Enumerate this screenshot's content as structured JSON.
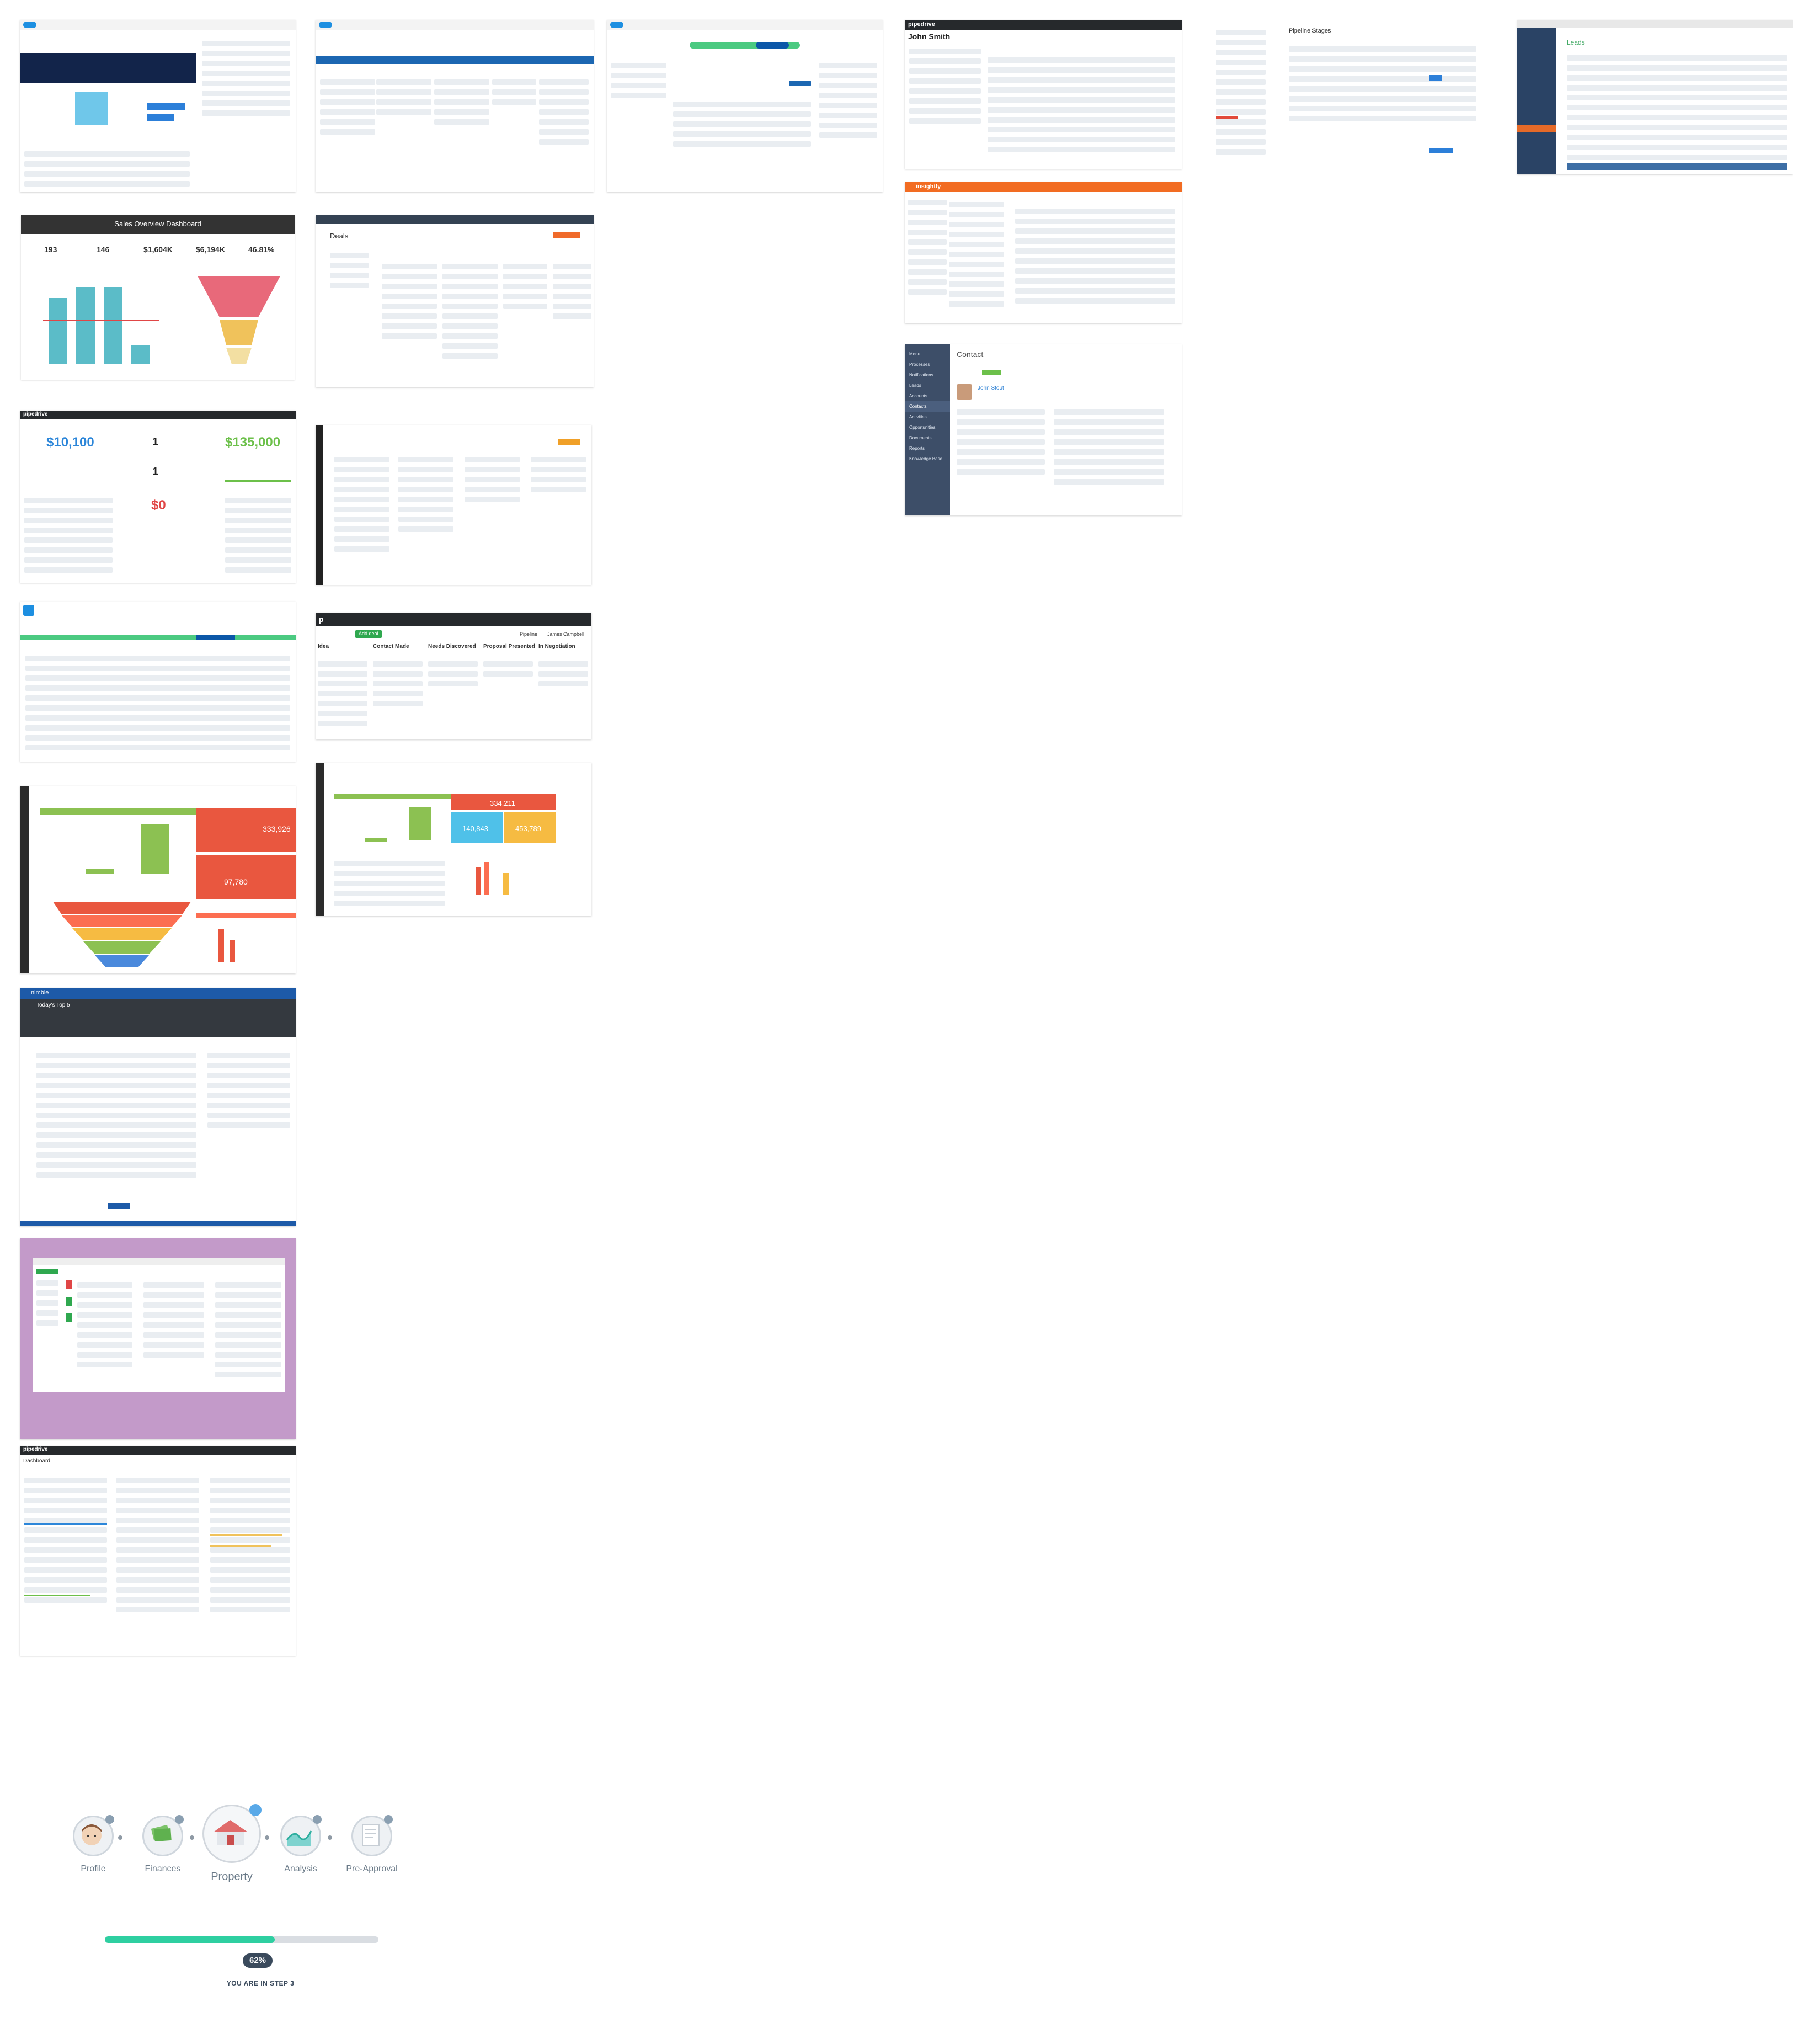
{
  "thumbnails": {
    "sales_dashboard": {
      "title": "Sales Overview Dashboard",
      "kpis": [
        "193",
        "146",
        "$1,604K",
        "$6,194K",
        "46.81%"
      ]
    },
    "deals_board": {
      "title": "Deals"
    },
    "pipedrive_dashboard": {
      "brand": "pipedrive",
      "won_value": "$10,100",
      "won_big": "$135,000",
      "lost_value": "$0",
      "counts": [
        "1",
        "1",
        "1"
      ]
    },
    "pipedrive_pipeline": {
      "brand": "p",
      "add_deal": "Add deal",
      "stages": [
        "Idea",
        "Contact Made",
        "Needs Discovered",
        "Proposal Presented",
        "In Negotiation"
      ],
      "pipeline_label": "Pipeline",
      "owner": "James Campbell"
    },
    "contact": {
      "title": "Contact",
      "name": "John Stout",
      "menu": [
        "Menu",
        "Processes",
        "Notifications",
        "Leads",
        "Accounts",
        "Contacts",
        "Activities",
        "Opportunities",
        "Documents",
        "Reports",
        "Knowledge Base"
      ]
    },
    "john_smith": {
      "brand": "pipedrive",
      "name": "John Smith"
    },
    "leads": {
      "title": "Leads"
    },
    "pipeline_stages": {
      "title": "Pipeline Stages"
    },
    "insightly": {
      "brand": "insightly"
    },
    "dash_a": {
      "values": [
        "333,926",
        "97,780"
      ]
    },
    "dash_b": {
      "values": [
        "334,211",
        "140,843",
        "453,789"
      ]
    },
    "nimble": {
      "brand": "nimble",
      "subtitle": "Today's Top 5"
    },
    "pipedrive_dashboard2": {
      "brand": "pipedrive",
      "title": "Dashboard"
    }
  },
  "progress": {
    "steps": [
      {
        "label": "Profile",
        "icon": "profile-icon"
      },
      {
        "label": "Finances",
        "icon": "finances-icon"
      },
      {
        "label": "Property",
        "icon": "property-icon"
      },
      {
        "label": "Analysis",
        "icon": "analysis-icon"
      },
      {
        "label": "Pre-Approval",
        "icon": "pre-approval-icon"
      }
    ],
    "percent_label": "62%",
    "fraction": 0.62,
    "status_text": "YOU ARE IN STEP 3",
    "current_step": 3,
    "colors": {
      "fill": "#2ecfa1",
      "track": "#d9dde2",
      "pill": "#3a4a5c",
      "active_badge": "#59a9e8"
    }
  }
}
